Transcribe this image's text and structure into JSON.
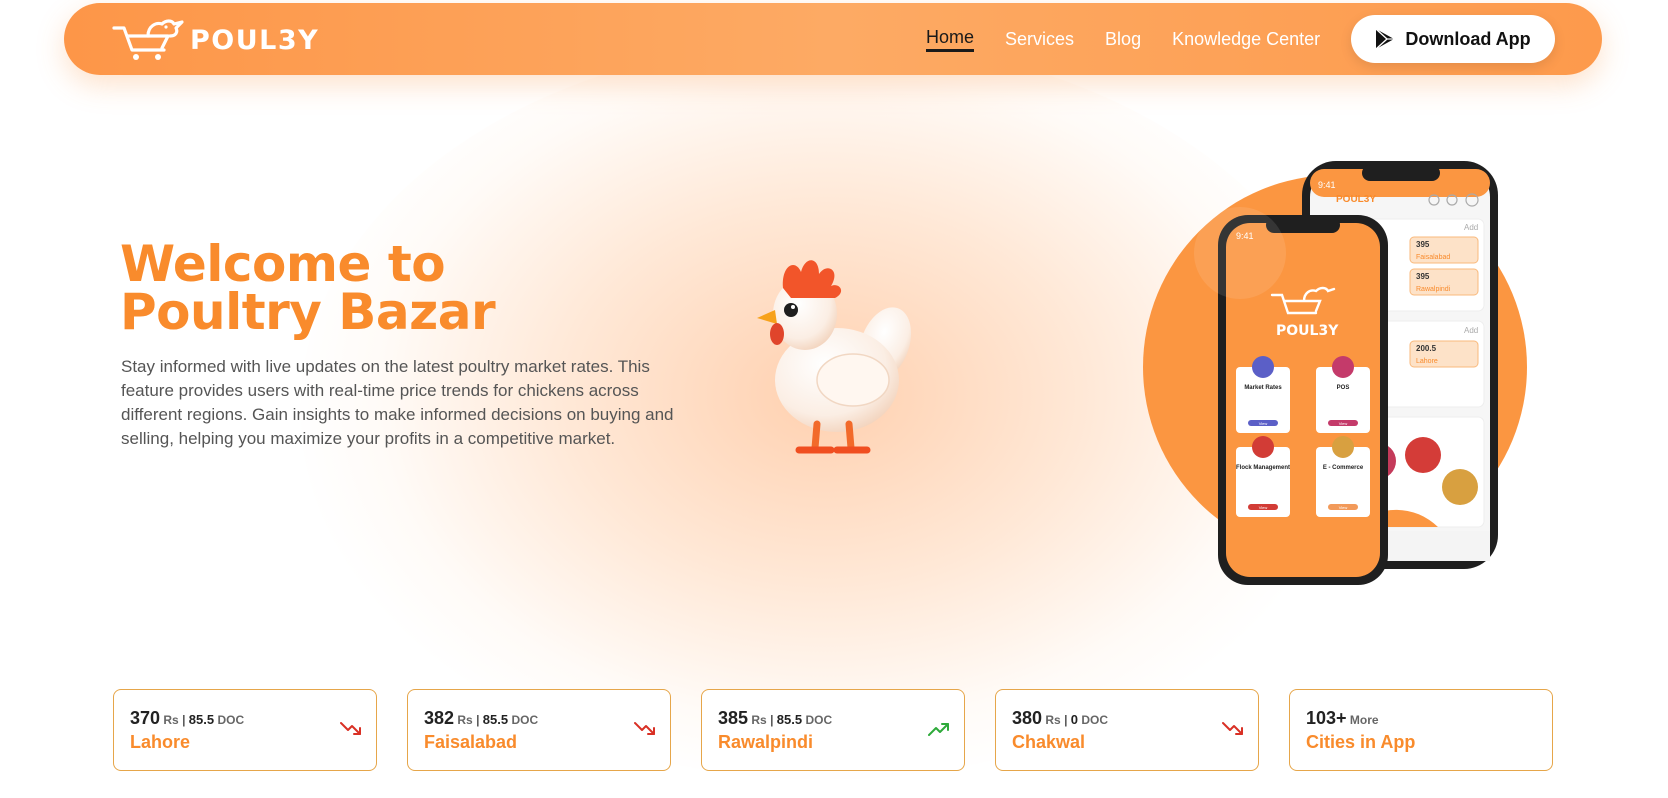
{
  "brand": {
    "logo_text": "POUL3Y",
    "accent": "#f98b2c"
  },
  "nav": {
    "links": [
      {
        "label": "Home",
        "active": true
      },
      {
        "label": "Services",
        "active": false
      },
      {
        "label": "Blog",
        "active": false
      },
      {
        "label": "Knowledge Center",
        "active": false
      }
    ],
    "download_label": "Download App",
    "download_icon": "google-play-icon"
  },
  "hero": {
    "title_line1": "Welcome to",
    "title_line2": "Poultry Bazar",
    "description": "Stay informed with live updates on the latest poultry market rates. This feature provides users with real-time price trends for chickens across different regions. Gain insights to make informed decisions on buying and selling, helping you maximize your profits in a competitive market."
  },
  "phone": {
    "front": {
      "time": "9:41",
      "logo_text": "POUL3Y",
      "tiles": [
        {
          "title": "Market Rates",
          "button": "View"
        },
        {
          "title": "POS",
          "button": "View"
        },
        {
          "title": "Flock Management",
          "button": "View"
        },
        {
          "title": "E - Commerce",
          "button": "View"
        }
      ]
    },
    "back": {
      "time": "9:41",
      "logo_text": "POUL3Y",
      "add_label": "Add",
      "rates": [
        {
          "value": "395",
          "city": "Faisalabad"
        },
        {
          "value": "395",
          "city": "Rawalpindi"
        },
        {
          "value": "200.5",
          "city": "Lahore"
        }
      ]
    }
  },
  "rates": [
    {
      "price": "370",
      "rs": "Rs",
      "sep": "|",
      "doc_value": "85.5",
      "doc": "DOC",
      "city": "Lahore",
      "trend": "down"
    },
    {
      "price": "382",
      "rs": "Rs",
      "sep": "|",
      "doc_value": "85.5",
      "doc": "DOC",
      "city": "Faisalabad",
      "trend": "down"
    },
    {
      "price": "385",
      "rs": "Rs",
      "sep": "|",
      "doc_value": "85.5",
      "doc": "DOC",
      "city": "Rawalpindi",
      "trend": "up"
    },
    {
      "price": "380",
      "rs": "Rs",
      "sep": "|",
      "doc_value": "0",
      "doc": "DOC",
      "city": "Chakwal",
      "trend": "down"
    }
  ],
  "more_card": {
    "count": "103+",
    "more_label": "More",
    "label": "Cities in App"
  },
  "colors": {
    "trend_down": "#d93025",
    "trend_up": "#2eaa3a",
    "card_border": "#e6a64a"
  }
}
